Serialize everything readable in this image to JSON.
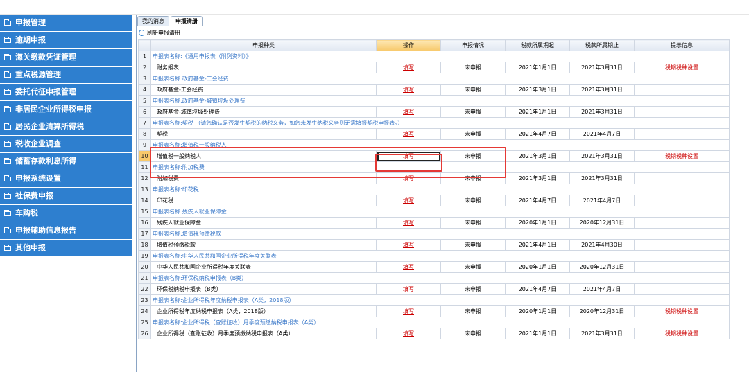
{
  "sidebar": {
    "items": [
      {
        "label": "申报管理"
      },
      {
        "label": "逾期申报"
      },
      {
        "label": "海关缴款凭证管理"
      },
      {
        "label": "重点税源管理"
      },
      {
        "label": "委托代征申报管理"
      },
      {
        "label": "非居民企业所得税申报"
      },
      {
        "label": "居民企业清算所得税"
      },
      {
        "label": "税收企业调查"
      },
      {
        "label": "储蓄存款利息所得"
      },
      {
        "label": "申报系统设置"
      },
      {
        "label": "社保费申报"
      },
      {
        "label": "车购税"
      },
      {
        "label": "申报辅助信息报告"
      },
      {
        "label": "其他申报"
      }
    ]
  },
  "tabs": [
    {
      "label": "我的消息"
    },
    {
      "label": "申报清册"
    }
  ],
  "toolbar": {
    "refresh_label": "刷新申报清册"
  },
  "table": {
    "headers": {
      "type": "申报种类",
      "action": "操作",
      "status": "申报情况",
      "start": "税款所属期起",
      "end": "税款所属期止",
      "tip": "提示信息"
    },
    "rows": [
      {
        "n": "1",
        "kind": "header",
        "text": "申报表名称:《通用申报表（附列资料）》"
      },
      {
        "n": "2",
        "kind": "item",
        "name": "财务报表",
        "action": "填写",
        "status": "未申报",
        "start": "2021年1月1日",
        "end": "2021年3月31日",
        "tip": "税期税种设置"
      },
      {
        "n": "3",
        "kind": "header",
        "text": "申报表名称:政府基金-工会经费"
      },
      {
        "n": "4",
        "kind": "item",
        "name": "政府基金-工会经费",
        "action": "填写",
        "status": "未申报",
        "start": "2021年3月1日",
        "end": "2021年3月31日",
        "tip": ""
      },
      {
        "n": "5",
        "kind": "header",
        "text": "申报表名称:政府基金-城镇垃圾处理费"
      },
      {
        "n": "6",
        "kind": "item",
        "name": "政府基金-城镇垃圾处理费",
        "action": "填写",
        "status": "未申报",
        "start": "2021年1月1日",
        "end": "2021年3月31日",
        "tip": ""
      },
      {
        "n": "7",
        "kind": "header",
        "text": "申报表名称:契税 （请您确认是否发生契税的纳税义务，如您未发生纳税义务则无需填报契税申报表。）"
      },
      {
        "n": "8",
        "kind": "item",
        "name": "契税",
        "action": "填写",
        "status": "未申报",
        "start": "2021年4月7日",
        "end": "2021年4月7日",
        "tip": ""
      },
      {
        "n": "9",
        "kind": "header",
        "text": "申报表名称:增值税一般纳税人"
      },
      {
        "n": "10",
        "kind": "item",
        "name": "增值税一般纳税人",
        "action": "填写",
        "status": "未申报",
        "start": "2021年3月1日",
        "end": "2021年3月31日",
        "tip": "税期税种设置",
        "selected": true
      },
      {
        "n": "11",
        "kind": "header",
        "text": "申报表名称:附加税费"
      },
      {
        "n": "12",
        "kind": "item",
        "name": "附加税费",
        "action": "填写",
        "status": "未申报",
        "start": "2021年3月1日",
        "end": "2021年3月31日",
        "tip": ""
      },
      {
        "n": "13",
        "kind": "header",
        "text": "申报表名称:印花税"
      },
      {
        "n": "14",
        "kind": "item",
        "name": "印花税",
        "action": "填写",
        "status": "未申报",
        "start": "2021年4月7日",
        "end": "2021年4月7日",
        "tip": ""
      },
      {
        "n": "15",
        "kind": "header",
        "text": "申报表名称:残疾人就业保障金"
      },
      {
        "n": "16",
        "kind": "item",
        "name": "残疾人就业保障金",
        "action": "填写",
        "status": "未申报",
        "start": "2020年1月1日",
        "end": "2020年12月31日",
        "tip": ""
      },
      {
        "n": "17",
        "kind": "header",
        "text": "申报表名称:增值税预缴税款"
      },
      {
        "n": "18",
        "kind": "item",
        "name": "增值税预缴税款",
        "action": "填写",
        "status": "未申报",
        "start": "2021年4月1日",
        "end": "2021年4月30日",
        "tip": ""
      },
      {
        "n": "19",
        "kind": "header",
        "text": "申报表名称:中华人民共和国企业所得税年度关联表"
      },
      {
        "n": "20",
        "kind": "item",
        "name": "中华人民共和国企业所得税年度关联表",
        "action": "填写",
        "status": "未申报",
        "start": "2020年1月1日",
        "end": "2020年12月31日",
        "tip": ""
      },
      {
        "n": "21",
        "kind": "header",
        "text": "申报表名称:环保税纳税申报表（B类）"
      },
      {
        "n": "22",
        "kind": "item",
        "name": "环保税纳税申报表（B类）",
        "action": "填写",
        "status": "未申报",
        "start": "2021年4月7日",
        "end": "2021年4月7日",
        "tip": ""
      },
      {
        "n": "23",
        "kind": "header",
        "text": "申报表名称:企业所得税年度纳税申报表（A类，2018版）"
      },
      {
        "n": "24",
        "kind": "item",
        "name": "企业所得税年度纳税申报表（A类，2018版）",
        "action": "填写",
        "status": "未申报",
        "start": "2020年1月1日",
        "end": "2020年12月31日",
        "tip": "税期税种设置"
      },
      {
        "n": "25",
        "kind": "header",
        "text": "申报表名称:企业所得税（查账征收）月季度预缴纳税申报表（A类）"
      },
      {
        "n": "26",
        "kind": "item",
        "name": "企业所得税（查账征收）月季度预缴纳税申报表（A类）",
        "action": "填写",
        "status": "未申报",
        "start": "2021年1月1日",
        "end": "2021年3月31日",
        "tip": "税期税种设置"
      }
    ]
  }
}
